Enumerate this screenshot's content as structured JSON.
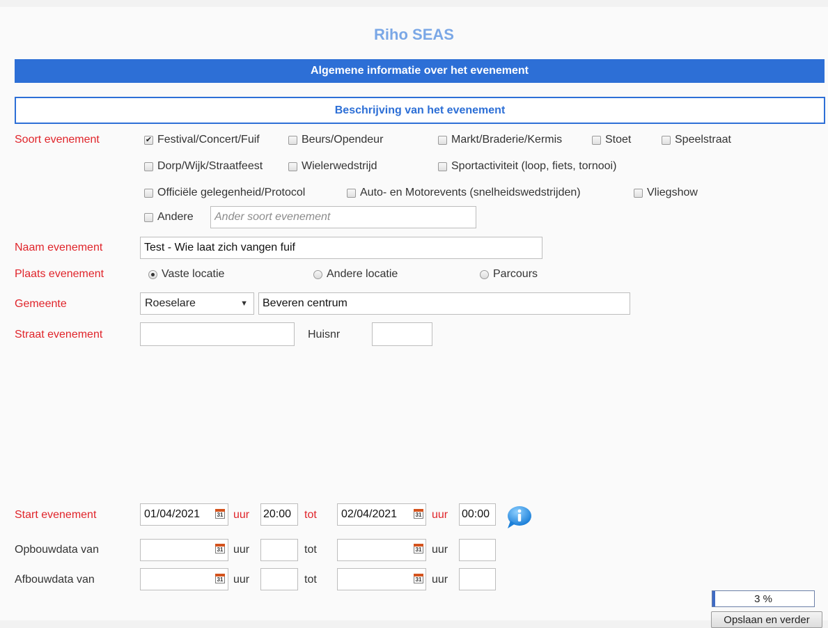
{
  "app": {
    "title": "Riho SEAS"
  },
  "main_banner": "Algemene informatie over het evenement",
  "section_banner": "Beschrijving van het evenement",
  "soort": {
    "label": "Soort evenement",
    "options": [
      {
        "label": "Festival/Concert/Fuif",
        "checked": true
      },
      {
        "label": "Beurs/Opendeur",
        "checked": false
      },
      {
        "label": "Markt/Braderie/Kermis",
        "checked": false
      },
      {
        "label": "Stoet",
        "checked": false
      },
      {
        "label": "Speelstraat",
        "checked": false
      },
      {
        "label": "Dorp/Wijk/Straatfeest",
        "checked": false
      },
      {
        "label": "Wielerwedstrijd",
        "checked": false
      },
      {
        "label": "Sportactiviteit (loop, fiets, tornooi)",
        "checked": false
      },
      {
        "label": "Officiële gelegenheid/Protocol",
        "checked": false
      },
      {
        "label": "Auto- en Motorevents (snelheidswedstrijden)",
        "checked": false
      },
      {
        "label": "Vliegshow",
        "checked": false
      },
      {
        "label": "Andere",
        "checked": false
      }
    ],
    "other_placeholder": "Ander soort evenement"
  },
  "naam": {
    "label": "Naam evenement",
    "value": "Test - Wie laat zich vangen fuif"
  },
  "plaats": {
    "label": "Plaats evenement",
    "options": [
      {
        "label": "Vaste locatie",
        "selected": true
      },
      {
        "label": "Andere locatie",
        "selected": false
      },
      {
        "label": "Parcours",
        "selected": false
      }
    ]
  },
  "gemeente": {
    "label": "Gemeente",
    "selected": "Roeselare",
    "deelgemeente": "Beveren centrum"
  },
  "straat": {
    "label": "Straat evenement",
    "value": "",
    "huisnr_label": "Huisnr",
    "huisnr_value": ""
  },
  "schedule": {
    "uur": "uur",
    "tot": "tot",
    "cal_day": "31",
    "rows": [
      {
        "label": "Start evenement",
        "from_date": "01/04/2021",
        "from_time": "20:00",
        "to_date": "02/04/2021",
        "to_time": "00:00"
      },
      {
        "label": "Opbouwdata van",
        "from_date": "",
        "from_time": "",
        "to_date": "",
        "to_time": ""
      },
      {
        "label": "Afbouwdata van",
        "from_date": "",
        "from_time": "",
        "to_date": "",
        "to_time": ""
      }
    ]
  },
  "progress": {
    "value": 0.03,
    "label": "3 %"
  },
  "save_button": "Opslaan en verder",
  "colors": {
    "banner": "#2d6fd6",
    "required_label": "#e0242a",
    "title": "#7aa7e6"
  },
  "icons": {
    "info": "info-icon",
    "calendar": "calendar-icon"
  }
}
